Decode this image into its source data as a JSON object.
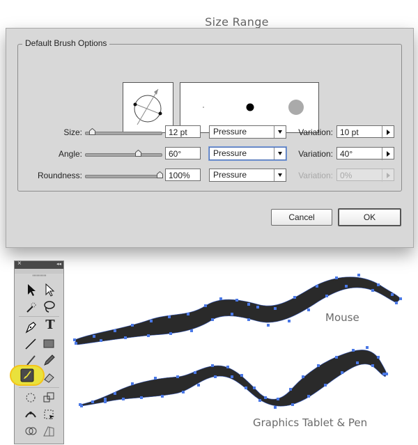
{
  "annotation": {
    "size_range": "Size Range"
  },
  "dialog": {
    "group_label": "Default Brush Options",
    "rows": [
      {
        "label": "Size:",
        "value": "12 pt",
        "mode": "Pressure",
        "variation_label": "Variation:",
        "variation_value": "10 pt",
        "slider_fraction": 0.07
      },
      {
        "label": "Angle:",
        "value": "60°",
        "mode": "Pressure",
        "variation_label": "Variation:",
        "variation_value": "40°",
        "slider_fraction": 0.67
      },
      {
        "label": "Roundness:",
        "value": "100%",
        "mode": "Pressure",
        "variation_label": "Variation:",
        "variation_value": "0%",
        "slider_fraction": 1.0
      }
    ],
    "cancel_label": "Cancel",
    "ok_label": "OK"
  },
  "toolbox": {
    "close": "×",
    "collapse": "◂◂"
  },
  "captions": {
    "mouse": "Mouse",
    "tablet": "Graphics Tablet & Pen"
  },
  "colors": {
    "highlight": "#e9e13c",
    "anchor": "#4a78e6",
    "stroke": "#2a2a2a"
  }
}
